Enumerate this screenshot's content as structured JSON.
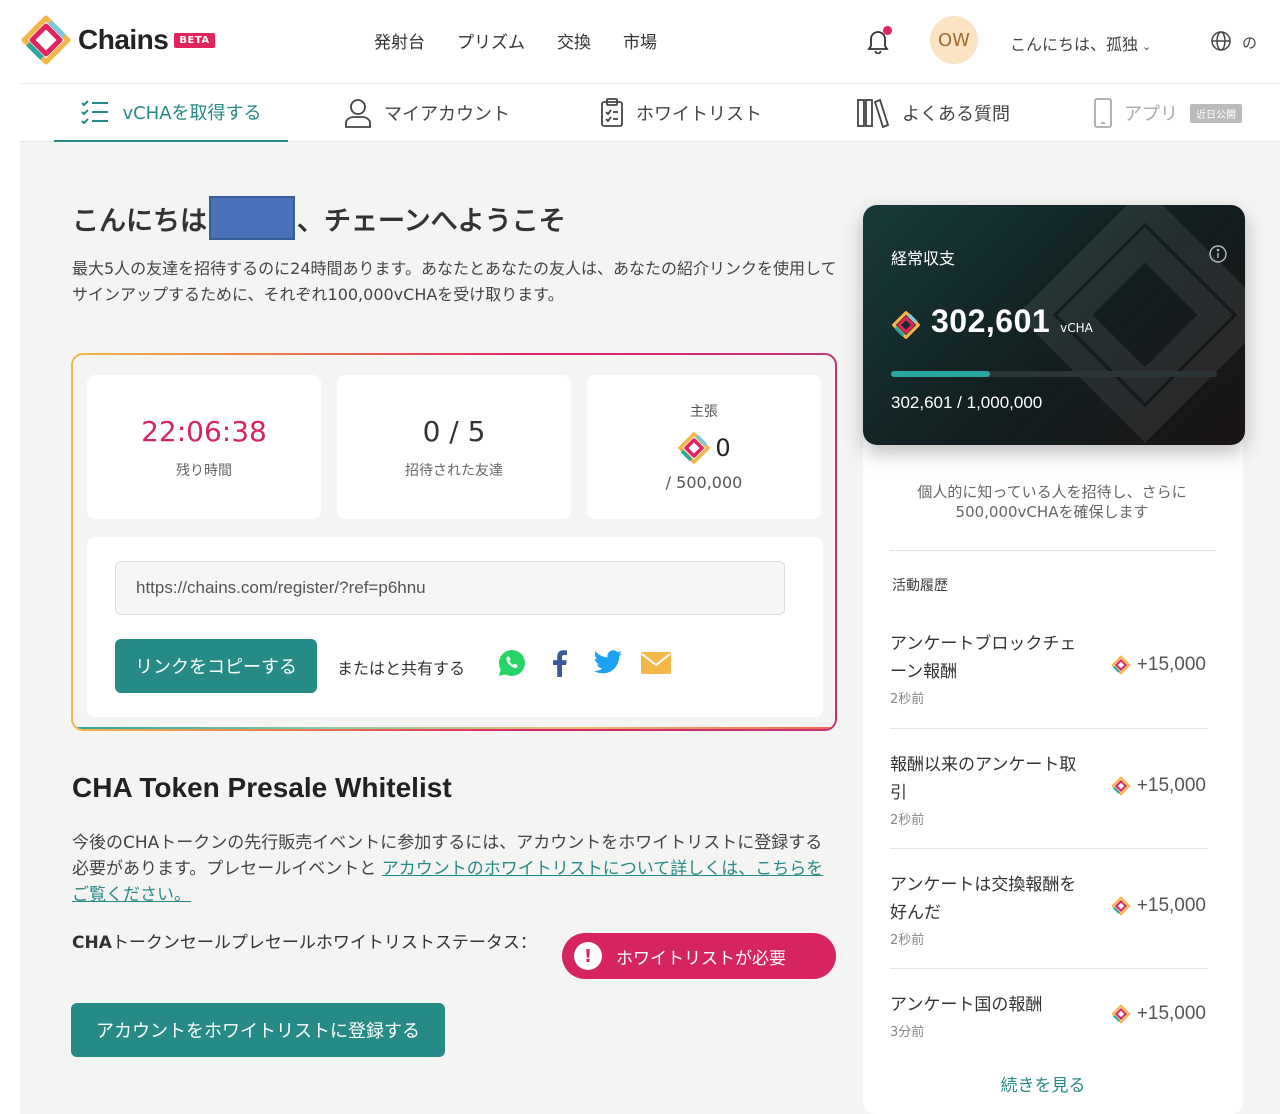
{
  "brand": {
    "name": "Chains",
    "badge": "BETA"
  },
  "nav": {
    "items": [
      "発射台",
      "プリズム",
      "交換",
      "市場"
    ],
    "avatar_initials": "OW",
    "greeting": "こんにちは、孤独",
    "language": "の"
  },
  "subnav": {
    "tabs": [
      {
        "label": "vCHAを取得する",
        "icon": "checklist-icon",
        "active": true
      },
      {
        "label": "マイアカウント",
        "icon": "user-icon"
      },
      {
        "label": "ホワイトリスト",
        "icon": "clipboard-icon"
      },
      {
        "label": "よくある質問",
        "icon": "books-icon"
      },
      {
        "label": "アプリ",
        "icon": "phone-icon",
        "badge": "近日公開"
      }
    ]
  },
  "welcome": {
    "title_prefix": "こんにちは",
    "title_suffix": "、チェーンへようこそ",
    "description": "最大5人の友達を招待するのに24時間あります。あなたとあなたの友人は、あなたの紹介リンクを使用してサインアップするために、それぞれ100,000vCHAを受け取ります。"
  },
  "invite": {
    "timer_value": "22:06:38",
    "timer_label": "残り時間",
    "invited_value": "0 / 5",
    "invited_label": "招待された友達",
    "claim_title": "主張",
    "claim_value": "0",
    "claim_total": "/ 500,000",
    "referral_url": "https://chains.com/register/?ref=p6hnu",
    "copy_button": "リンクをコピーする",
    "share_label": "またはと共有する",
    "share_icons": [
      "whatsapp-icon",
      "facebook-icon",
      "twitter-icon",
      "email-icon"
    ]
  },
  "whitelist": {
    "title": "CHA Token Presale Whitelist",
    "desc_text": "今後のCHAトークンの先行販売イベントに参加するには、アカウントをホワイトリストに登録する必要があります。プレセールイベントと ",
    "desc_link": "アカウントのホワイトリストについて詳しくは、こちらをご覧ください。",
    "status_label_bold": "CHA",
    "status_label": "トークンセールプレセールホワイトリストステータス：",
    "status_badge": "ホワイトリストが必要",
    "register_button": "アカウントをホワイトリストに登録する"
  },
  "balance": {
    "label": "経常収支",
    "value": "302,601",
    "unit": "vCHA",
    "progress": 0.3026,
    "progress_text": "302,601 / 1,000,000"
  },
  "sidebar": {
    "invite_more": "個人的に知っている人を招待し、さらに500,000vCHAを確保します",
    "activity_title": "活動履歴",
    "activities": [
      {
        "name": "アンケートブロックチェーン報酬",
        "time": "2秒前",
        "amount": "+15,000"
      },
      {
        "name": "報酬以来のアンケート取引",
        "time": "2秒前",
        "amount": "+15,000"
      },
      {
        "name": "アンケートは交換報酬を好んだ",
        "time": "2秒前",
        "amount": "+15,000"
      },
      {
        "name": "アンケート国の報酬",
        "time": "3分前",
        "amount": "+15,000"
      }
    ],
    "see_more": "続きを見る"
  },
  "colors": {
    "accent": "#268a86",
    "alert": "#d6245e"
  }
}
